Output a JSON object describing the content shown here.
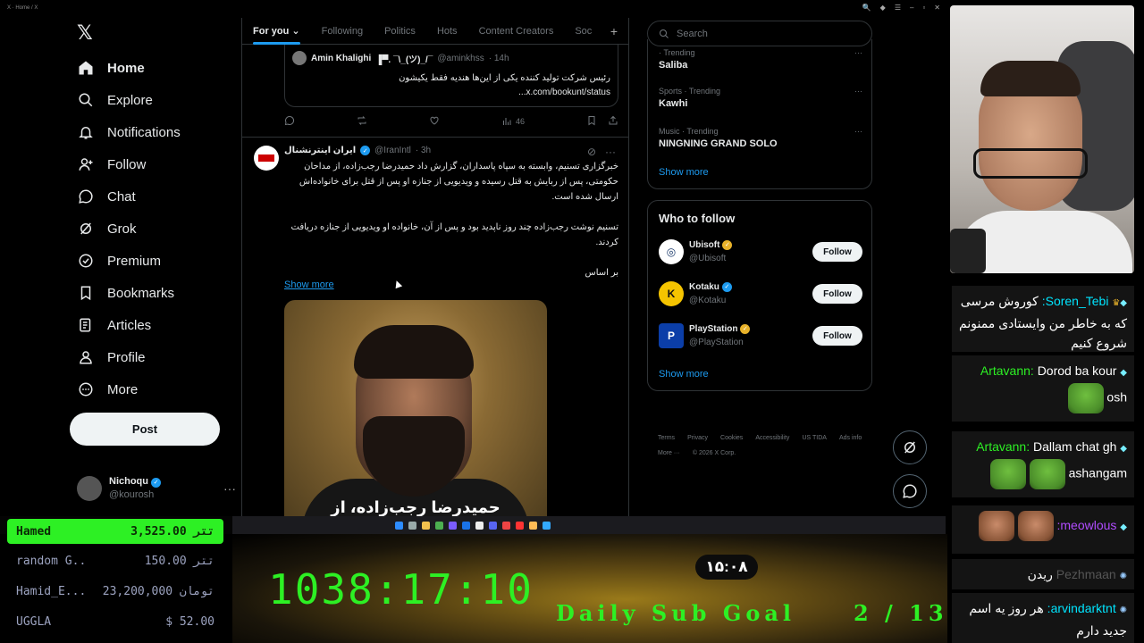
{
  "browser": {
    "title": "X · Home / X"
  },
  "nav": {
    "items": [
      {
        "label": "Home",
        "icon": "home-icon"
      },
      {
        "label": "Explore",
        "icon": "search-icon"
      },
      {
        "label": "Notifications",
        "icon": "bell-icon"
      },
      {
        "label": "Follow",
        "icon": "person-add-icon"
      },
      {
        "label": "Chat",
        "icon": "chat-bubble-icon"
      },
      {
        "label": "Grok",
        "icon": "grok-icon"
      },
      {
        "label": "Premium",
        "icon": "premium-icon"
      },
      {
        "label": "Bookmarks",
        "icon": "bookmark-icon"
      },
      {
        "label": "Articles",
        "icon": "articles-icon"
      },
      {
        "label": "Profile",
        "icon": "profile-icon"
      },
      {
        "label": "More",
        "icon": "more-icon"
      }
    ],
    "post_label": "Post",
    "account": {
      "name": "Nichoqu",
      "handle": "@kourosh"
    }
  },
  "timeline": {
    "tabs": [
      "For you",
      "Following",
      "Politics",
      "Hots",
      "Content Creators",
      "Soc"
    ],
    "quoted": {
      "name": "Amin Khalighi",
      "name_suffix": "▐▀. ¯\\_(ツ)_/¯",
      "handle": "@aminkhss",
      "time": "· 14h",
      "line1": "رئیس شرکت تولید کننده یکی از این‌ها هندیه فقط یکیشون",
      "line2": "x.com/bookunt/status..."
    },
    "quoted_actions": {
      "views": "46"
    },
    "tweet": {
      "name": "ایران اینترنشنال",
      "handle": "@IranIntl",
      "time": "· 3h",
      "para1": "خبرگزاری تسنیم، وابسته به سپاه پاسداران، گزارش داد حمیدرضا رجب‌زاده، از مداحان حکومتی، پس از ربایش به قتل رسیده و ویدیویی از جنازه او پس از قتل برای خانواده‌اش ارسال شده است.",
      "para2": "تسنیم نوشت رجب‌زاده چند روز ناپدید بود و پس از آن، خانواده او ویدیویی از جنازه دریافت کردند.",
      "para3": "بر اساس",
      "show_more": "Show more",
      "image_caption": "حمیدرضا رجب‌زاده، از"
    }
  },
  "sidebar": {
    "search_placeholder": "Search",
    "trends": [
      {
        "category": "· Trending",
        "name": "Saliba"
      },
      {
        "category": "Sports · Trending",
        "name": "Kawhi"
      },
      {
        "category": "Music · Trending",
        "name": "NINGNING GRAND SOLO"
      }
    ],
    "trends_show_more": "Show more",
    "who_to_follow_title": "Who to follow",
    "who_to_follow": [
      {
        "name": "Ubisoft",
        "handle": "@Ubisoft",
        "badge": "gold",
        "logo": "ubisoft-logo-icon",
        "logo_color": "#ffffff"
      },
      {
        "name": "Kotaku",
        "handle": "@Kotaku",
        "badge": "blue",
        "logo": "kotaku-logo-icon",
        "logo_color": "#f5c400"
      },
      {
        "name": "PlayStation",
        "handle": "@PlayStation",
        "badge": "gold",
        "logo": "playstation-logo-icon",
        "logo_color": "#0b3ea8"
      }
    ],
    "follow_label": "Follow",
    "wtf_show_more": "Show more",
    "footer": [
      "Terms",
      "Privacy",
      "Cookies",
      "Accessibility",
      "US TIDA",
      "Ads info",
      "More ···",
      "© 2026 X Corp."
    ]
  },
  "chat": {
    "messages": [
      {
        "user": "Soren_Tebi",
        "user_color": "#00e5ff",
        "text": "کوروش مرسی که به خاطر من وایستادی ممنونم شروع کنیم"
      },
      {
        "user": "Artavann",
        "user_color": "#2df024",
        "text": "Dorod ba kour",
        "extra": "osh"
      },
      {
        "user": "Artavann",
        "user_color": "#2df024",
        "text": "Dallam chat gh",
        "extra": "ashangam"
      },
      {
        "user": "meowlous",
        "user_color": "#b14cff",
        "text": ""
      },
      {
        "user": "Pezhmaan",
        "user_color": "#555555",
        "text": "ریدن"
      },
      {
        "user": "arvindarktnt",
        "user_color": "#00e5ff",
        "text": "هر روز یه اسم جدید دارم"
      }
    ]
  },
  "donations": [
    {
      "name": "Hamed",
      "amount": "3,525.00 تتر"
    },
    {
      "name": "random G..",
      "amount": "150.00 تتر"
    },
    {
      "name": "Hamid_E...",
      "amount": "23,200,000 تومان"
    },
    {
      "name": "UGGLA",
      "amount": "$ 52.00"
    }
  ],
  "overlay": {
    "timer": "1038:17:10",
    "clock": "۱۵:۰۸",
    "goal_label": "Daily Sub Goal",
    "goal_count": "2 / 13"
  },
  "colors": {
    "accent": "#1d9bf0",
    "neon_green": "#2df024"
  }
}
